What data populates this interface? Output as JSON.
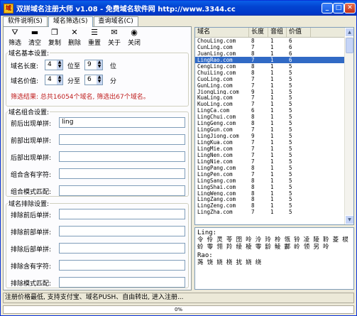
{
  "window": {
    "title": "双拼域名注册大师 v1.08 - 免费域名软件网 http://www.3344.cc"
  },
  "tabs": [
    "软件说明(S)",
    "域名筛选(S)",
    "查询域名(C)"
  ],
  "toolbar": [
    {
      "label": "筛选",
      "icon": "filter-icon",
      "glyph": "⛛"
    },
    {
      "label": "清空",
      "icon": "clear-icon",
      "glyph": "▬"
    },
    {
      "label": "复制",
      "icon": "copy-icon",
      "glyph": "❐"
    },
    {
      "label": "删除",
      "icon": "delete-icon",
      "glyph": "✕"
    },
    {
      "label": "重置",
      "icon": "reset-icon",
      "glyph": "☰"
    },
    {
      "label": "关于",
      "icon": "about-icon",
      "glyph": "✉"
    },
    {
      "label": "关闭",
      "icon": "close-icon",
      "glyph": "◉"
    }
  ],
  "basic": {
    "legend": "域名基本设置:",
    "length_label": "域名长度:",
    "length_from": "4",
    "length_to_label": "位至",
    "length_to": "9",
    "length_unit": "位",
    "price_label": "域名价值:",
    "price_from": "4",
    "price_to_label": "分至",
    "price_to": "6",
    "price_unit": "分",
    "result": "筛选结果: 总共16054个域名, 筛选出67个域名。"
  },
  "combo": {
    "legend": "域名组合设置:",
    "fields": [
      {
        "label": "前后出现单拼:",
        "value": "ling"
      },
      {
        "label": "前部出现单拼:",
        "value": ""
      },
      {
        "label": "后部出现单拼:",
        "value": ""
      },
      {
        "label": "组合含有字符:",
        "value": ""
      },
      {
        "label": "组合模式匹配:",
        "value": ""
      }
    ]
  },
  "exclude": {
    "legend": "域名排除设置:",
    "fields": [
      {
        "label": "排除前后单拼:",
        "value": ""
      },
      {
        "label": "排除前部单拼:",
        "value": ""
      },
      {
        "label": "排除后部单拼:",
        "value": ""
      },
      {
        "label": "排除含有字符:",
        "value": ""
      },
      {
        "label": "排除模式匹配:",
        "value": ""
      }
    ]
  },
  "grid": {
    "headers": [
      "域名",
      "长度",
      "音组",
      "价值"
    ],
    "selected_index": 3,
    "rows": [
      [
        "ChouLing.com",
        "8",
        "1",
        "6"
      ],
      [
        "CunLing.com",
        "7",
        "1",
        "6"
      ],
      [
        "JuanLing.com",
        "8",
        "1",
        "6"
      ],
      [
        "LingRao.com",
        "7",
        "1",
        "6"
      ],
      [
        "CengLing.com",
        "8",
        "1",
        "5"
      ],
      [
        "ChuiLing.com",
        "8",
        "1",
        "5"
      ],
      [
        "CuoLing.com",
        "7",
        "1",
        "5"
      ],
      [
        "GunLing.com",
        "7",
        "1",
        "5"
      ],
      [
        "JiongLing.com",
        "9",
        "1",
        "5"
      ],
      [
        "KuaLing.com",
        "7",
        "1",
        "5"
      ],
      [
        "KuoLing.com",
        "7",
        "1",
        "5"
      ],
      [
        "LingCa.com",
        "6",
        "1",
        "5"
      ],
      [
        "LingChui.com",
        "8",
        "1",
        "5"
      ],
      [
        "LingGeng.com",
        "8",
        "1",
        "5"
      ],
      [
        "LingGun.com",
        "7",
        "1",
        "5"
      ],
      [
        "LingJiong.com",
        "9",
        "1",
        "5"
      ],
      [
        "LingKua.com",
        "7",
        "1",
        "5"
      ],
      [
        "LingMie.com",
        "7",
        "1",
        "5"
      ],
      [
        "LingNen.com",
        "7",
        "1",
        "5"
      ],
      [
        "LingNie.com",
        "7",
        "1",
        "5"
      ],
      [
        "LingPang.com",
        "8",
        "1",
        "5"
      ],
      [
        "LingPen.com",
        "7",
        "1",
        "5"
      ],
      [
        "LingSang.com",
        "8",
        "1",
        "5"
      ],
      [
        "LingShai.com",
        "8",
        "1",
        "5"
      ],
      [
        "LingWeng.com",
        "8",
        "1",
        "5"
      ],
      [
        "LingZang.com",
        "8",
        "1",
        "5"
      ],
      [
        "LingZeng.com",
        "8",
        "1",
        "5"
      ],
      [
        "LingZha.com",
        "7",
        "1",
        "5"
      ]
    ]
  },
  "info": {
    "line1_head": "Ling:",
    "line1_body": "令 伶 灵 苓 囹 呤 泠 玲 柃 瓴 铃 凌 陵 聆 菱 棂 蛉 零 翎 羚 绫 棱 零 龄 鲮 酃 岭 领 另 呤",
    "line2_head": "Rao:",
    "line2_body": "荛 饶 娆 桡 扰 娆 绕"
  },
  "status": {
    "text": "注册价格最低, 支持支付宝、域名PUSH、自由转出, 进入注册...",
    "progress": "0%",
    "progress_value": 0
  }
}
